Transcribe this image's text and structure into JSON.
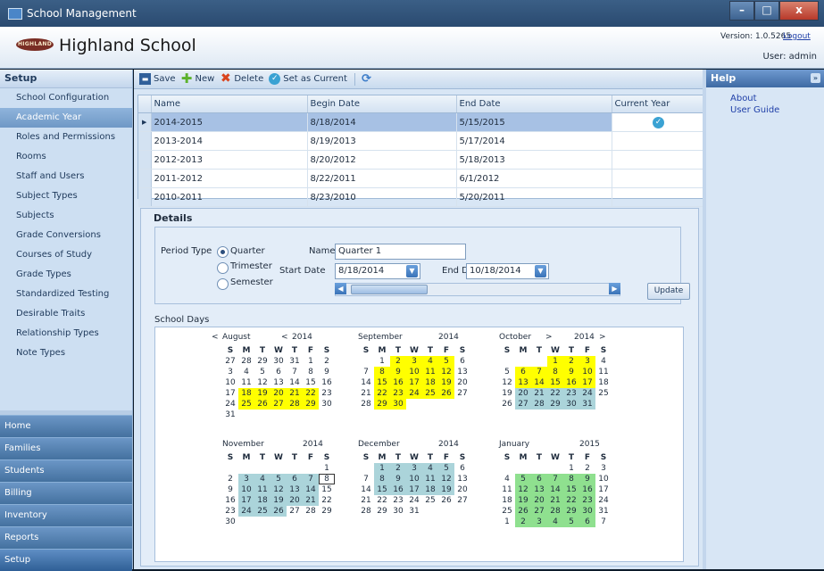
{
  "window": {
    "title": "School Management"
  },
  "header": {
    "school_name": "Highland School",
    "logo_text": "HIGHLAND",
    "version": "Version: 1.0.5265",
    "logout": "Logout",
    "user": "User: admin"
  },
  "nav": {
    "title": "Setup",
    "items": [
      "School Configuration",
      "Academic Year",
      "Roles and Permissions",
      "Rooms",
      "Staff and Users",
      "Subject Types",
      "Subjects",
      "Grade Conversions",
      "Courses of Study",
      "Grade Types",
      "Standardized Testing",
      "Desirable Traits",
      "Relationship Types",
      "Note Types"
    ],
    "groups": [
      "Home",
      "Families",
      "Students",
      "Billing",
      "Inventory",
      "Reports",
      "Setup"
    ]
  },
  "toolbar": {
    "save": "Save",
    "new": "New",
    "delete": "Delete",
    "set_current": "Set as Current"
  },
  "grid": {
    "headers": {
      "name": "Name",
      "begin": "Begin Date",
      "end": "End Date",
      "current": "Current Year"
    },
    "rows": [
      {
        "name": "2014-2015",
        "begin": "8/18/2014",
        "end": "5/15/2015",
        "current": true
      },
      {
        "name": "2013-2014",
        "begin": "8/19/2013",
        "end": "5/17/2014",
        "current": false
      },
      {
        "name": "2012-2013",
        "begin": "8/20/2012",
        "end": "5/18/2013",
        "current": false
      },
      {
        "name": "2011-2012",
        "begin": "8/22/2011",
        "end": "6/1/2012",
        "current": false
      },
      {
        "name": "2010-2011",
        "begin": "8/23/2010",
        "end": "5/20/2011",
        "current": false
      }
    ]
  },
  "details": {
    "title": "Details",
    "period_type_label": "Period Type",
    "options": [
      "Quarter",
      "Trimester",
      "Semester"
    ],
    "selected": "Quarter",
    "name_label": "Name",
    "name_value": "Quarter 1",
    "start_label": "Start Date",
    "start_value": "8/18/2014",
    "end_label": "End Date",
    "end_value": "10/18/2014",
    "update": "Update",
    "school_days_label": "School Days"
  },
  "calendar": {
    "dow": [
      "S",
      "M",
      "T",
      "W",
      "T",
      "F",
      "S"
    ],
    "months": [
      {
        "name": "August",
        "year": "2014",
        "prev": "<",
        "yprev": "<",
        "weeks": [
          [
            "27",
            "28",
            "29",
            "30",
            "31",
            "1",
            "2"
          ],
          [
            "3",
            "4",
            "5",
            "6",
            "7",
            "8",
            "9"
          ],
          [
            "10",
            "11",
            "12",
            "13",
            "14",
            "15",
            "16"
          ],
          [
            "17",
            "18Y",
            "19Y",
            "20Y",
            "21Y",
            "22Y",
            "23"
          ],
          [
            "24",
            "25Y",
            "26Y",
            "27Y",
            "28Y",
            "29Y",
            "30"
          ],
          [
            "31"
          ]
        ]
      },
      {
        "name": "September",
        "year": "2014",
        "weeks": [
          [
            "",
            "1",
            "2Y",
            "3Y",
            "4Y",
            "5Y",
            "6"
          ],
          [
            "7",
            "8Y",
            "9Y",
            "10Y",
            "11Y",
            "12Y",
            "13"
          ],
          [
            "14",
            "15Y",
            "16Y",
            "17Y",
            "18Y",
            "19Y",
            "20"
          ],
          [
            "21",
            "22Y",
            "23Y",
            "24Y",
            "25Y",
            "26Y",
            "27"
          ],
          [
            "28",
            "29Y",
            "30Y"
          ]
        ]
      },
      {
        "name": "October",
        "year": "2014",
        "next": ">",
        "ynext": ">",
        "weeks": [
          [
            "",
            "",
            "",
            "1Y",
            "2Y",
            "3Y",
            "4"
          ],
          [
            "5",
            "6Y",
            "7Y",
            "8Y",
            "9Y",
            "10Y",
            "11"
          ],
          [
            "12",
            "13Y",
            "14Y",
            "15Y",
            "16Y",
            "17Y",
            "18"
          ],
          [
            "19",
            "20B",
            "21B",
            "22B",
            "23B",
            "24B",
            "25"
          ],
          [
            "26",
            "27B",
            "28B",
            "29B",
            "30B",
            "31B"
          ]
        ]
      },
      {
        "name": "November",
        "year": "2014",
        "weeks": [
          [
            "",
            "",
            "",
            "",
            "",
            "",
            "1"
          ],
          [
            "2",
            "3B",
            "4B",
            "5B",
            "6B",
            "7B",
            "8T"
          ],
          [
            "9",
            "10B",
            "11B",
            "12B",
            "13B",
            "14B",
            "15"
          ],
          [
            "16",
            "17B",
            "18B",
            "19B",
            "20B",
            "21B",
            "22"
          ],
          [
            "23",
            "24B",
            "25B",
            "26B",
            "27",
            "28",
            "29"
          ],
          [
            "30"
          ]
        ]
      },
      {
        "name": "December",
        "year": "2014",
        "weeks": [
          [
            "",
            "1B",
            "2B",
            "3B",
            "4B",
            "5B",
            "6"
          ],
          [
            "7",
            "8B",
            "9B",
            "10B",
            "11B",
            "12B",
            "13"
          ],
          [
            "14",
            "15B",
            "16B",
            "17B",
            "18B",
            "19B",
            "20"
          ],
          [
            "21",
            "22",
            "23",
            "24",
            "25",
            "26",
            "27"
          ],
          [
            "28",
            "29",
            "30",
            "31"
          ]
        ]
      },
      {
        "name": "January",
        "year": "2015",
        "weeks": [
          [
            "",
            "",
            "",
            "",
            "1",
            "2",
            "3"
          ],
          [
            "4",
            "5G",
            "6G",
            "7G",
            "8G",
            "9G",
            "10"
          ],
          [
            "11",
            "12G",
            "13G",
            "14G",
            "15G",
            "16G",
            "17"
          ],
          [
            "18",
            "19G",
            "20G",
            "21G",
            "22G",
            "23G",
            "24"
          ],
          [
            "25",
            "26G",
            "27G",
            "28G",
            "29G",
            "30G",
            "31"
          ],
          [
            "1",
            "2G",
            "3G",
            "4G",
            "5G",
            "6G",
            "7"
          ]
        ]
      }
    ]
  },
  "help": {
    "title": "Help",
    "links": [
      "About",
      "User Guide"
    ]
  }
}
